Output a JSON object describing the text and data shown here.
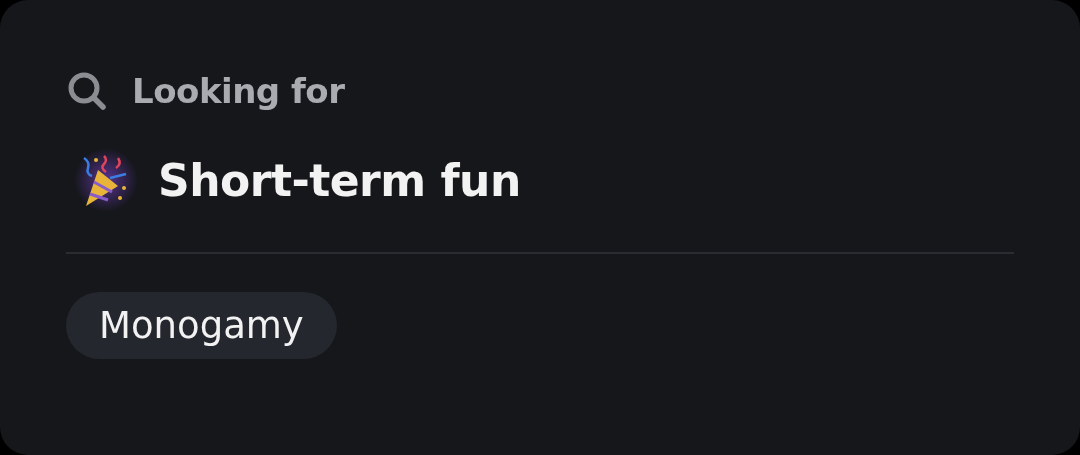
{
  "section": {
    "heading": "Looking for",
    "value": "Short-term fun"
  },
  "tags": [
    {
      "label": "Monogamy"
    }
  ]
}
